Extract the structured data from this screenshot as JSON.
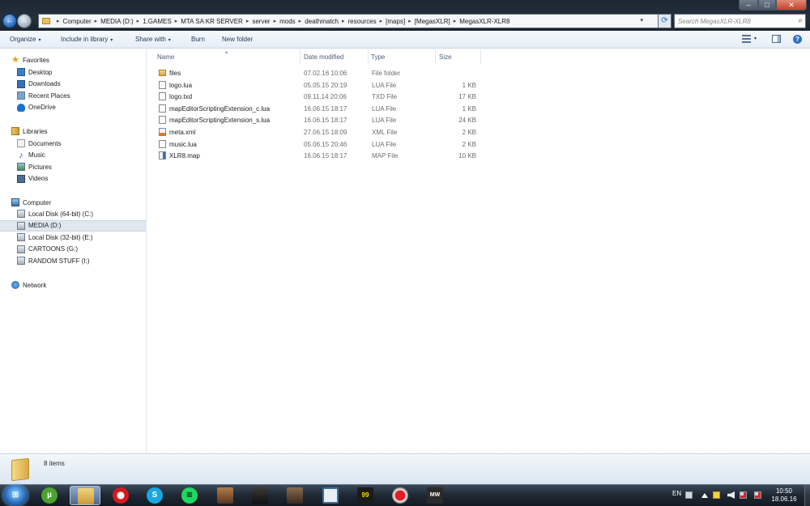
{
  "window": {
    "minimize_icon": "minimize-icon",
    "maximize_icon": "maximize-icon",
    "close_icon": "close-icon",
    "minimize_glyph": "–",
    "maximize_glyph": "□",
    "close_glyph": "✕"
  },
  "address": {
    "breadcrumbs": [
      "Computer",
      "MEDIA (D:)",
      "1.GAMES",
      "MTA SA KR SERVER",
      "server",
      "mods",
      "deathmatch",
      "resources",
      "[maps]",
      "[MegasXLR]",
      "MegasXLR-XLR8"
    ],
    "separator": "▸",
    "dropdown_glyph": "▾",
    "refresh_glyph": "⟳"
  },
  "search": {
    "placeholder": "Search MegasXLR-XLR8",
    "icon": "search-icon",
    "glyph": "⌕"
  },
  "toolbar": {
    "organize": "Organize",
    "include_in_library": "Include in library",
    "share_with": "Share with",
    "burn": "Burn",
    "new_folder": "New folder",
    "dropdown_glyph": "▾",
    "help_glyph": "?"
  },
  "sidebar": {
    "favorites_label": "Favorites",
    "favorites": [
      {
        "label": "Desktop",
        "icon": "desktop-icon"
      },
      {
        "label": "Downloads",
        "icon": "downloads-icon"
      },
      {
        "label": "Recent Places",
        "icon": "recent-places-icon"
      },
      {
        "label": "OneDrive",
        "icon": "onedrive-icon"
      }
    ],
    "libraries_label": "Libraries",
    "libraries": [
      {
        "label": "Documents",
        "icon": "documents-icon"
      },
      {
        "label": "Music",
        "icon": "music-icon"
      },
      {
        "label": "Pictures",
        "icon": "pictures-icon"
      },
      {
        "label": "Videos",
        "icon": "videos-icon"
      }
    ],
    "computer_label": "Computer",
    "drives": [
      {
        "label": "Local Disk (64-bit) (C:)",
        "selected": false
      },
      {
        "label": "MEDIA (D:)",
        "selected": true
      },
      {
        "label": "Local Disk (32-bit) (E:)",
        "selected": false
      },
      {
        "label": "CARTOONS (G:)",
        "selected": false
      },
      {
        "label": "RANDOM STUFF (I:)",
        "selected": false
      }
    ],
    "network_label": "Network",
    "star_glyph": "★",
    "music_glyph": "♪"
  },
  "columns": {
    "name": "Name",
    "date_modified": "Date modified",
    "type": "Type",
    "size": "Size",
    "sort_glyph": "▴"
  },
  "files": [
    {
      "name": "files",
      "date": "07.02.16 10:06",
      "type": "File folder",
      "size": "",
      "kind": "folder"
    },
    {
      "name": "logo.lua",
      "date": "05.05.15 20:19",
      "type": "LUA File",
      "size": "1 KB",
      "kind": "file"
    },
    {
      "name": "logo.txd",
      "date": "09.11.14 20:06",
      "type": "TXD File",
      "size": "17 KB",
      "kind": "file"
    },
    {
      "name": "mapEditorScriptingExtension_c.lua",
      "date": "16.06.15 18:17",
      "type": "LUA File",
      "size": "1 KB",
      "kind": "file"
    },
    {
      "name": "mapEditorScriptingExtension_s.lua",
      "date": "16.06.15 18:17",
      "type": "LUA File",
      "size": "24 KB",
      "kind": "file"
    },
    {
      "name": "meta.xml",
      "date": "27.06.15 18:09",
      "type": "XML File",
      "size": "2 KB",
      "kind": "xml"
    },
    {
      "name": "music.lua",
      "date": "05.06.15 20:46",
      "type": "LUA File",
      "size": "2 KB",
      "kind": "file"
    },
    {
      "name": "XLR8.map",
      "date": "16.06.15 18:17",
      "type": "MAP File",
      "size": "10 KB",
      "kind": "map"
    }
  ],
  "details": {
    "item_count": "8 items"
  },
  "taskbar": {
    "start_glyph": "⊞",
    "apps": [
      {
        "name": "utorrent",
        "glyph": "µ",
        "cls": "g-ut",
        "active": false
      },
      {
        "name": "explorer",
        "glyph": "",
        "cls": "g-ex",
        "active": true
      },
      {
        "name": "opera",
        "glyph": "",
        "cls": "g-op",
        "active": false
      },
      {
        "name": "skype",
        "glyph": "S",
        "cls": "g-sk",
        "active": false
      },
      {
        "name": "spotify",
        "glyph": "≋",
        "cls": "g-sp",
        "active": false
      },
      {
        "name": "game-1",
        "glyph": "",
        "cls": "g-p1",
        "active": false
      },
      {
        "name": "game-2",
        "glyph": "",
        "cls": "g-p2",
        "active": false
      },
      {
        "name": "game-3",
        "glyph": "",
        "cls": "g-p3",
        "active": false
      },
      {
        "name": "window-app",
        "glyph": "",
        "cls": "g-wn",
        "active": false
      },
      {
        "name": "foobar",
        "glyph": "99",
        "cls": "g-99",
        "active": false
      },
      {
        "name": "recorder",
        "glyph": "",
        "cls": "g-rec",
        "active": false
      },
      {
        "name": "nfs-most-wanted",
        "glyph": "MW",
        "cls": "g-mw",
        "active": false
      }
    ],
    "language": "EN",
    "time": "10:50",
    "date": "18.06.16"
  }
}
